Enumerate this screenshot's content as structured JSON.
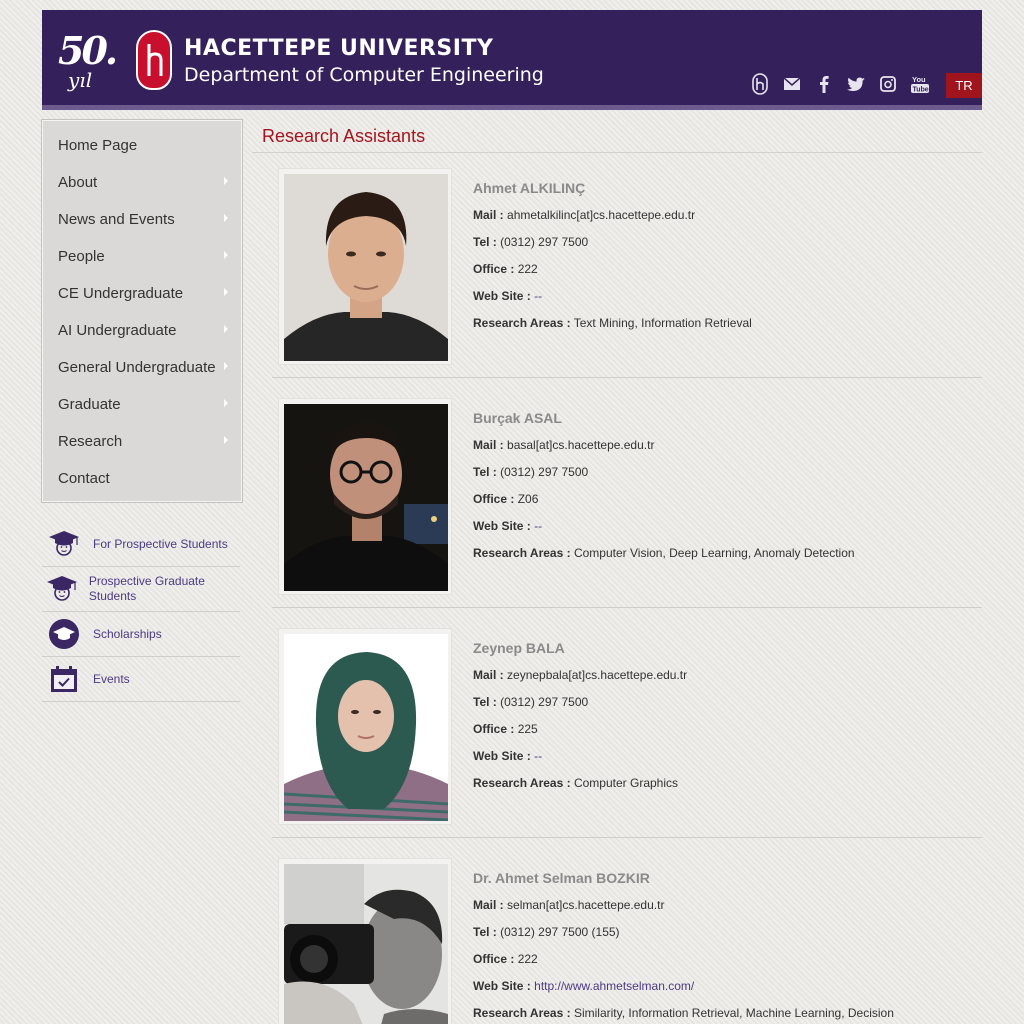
{
  "header": {
    "anniversary_number": "50.",
    "anniversary_word": "yıl",
    "university": "HACETTEPE UNIVERSITY",
    "department": "Department of Computer Engineering",
    "social_icons": [
      "hacettepe-icon",
      "mail-icon",
      "facebook-icon",
      "twitter-icon",
      "instagram-icon",
      "youtube-icon"
    ],
    "youtube_text": "You\nTube",
    "lang_button": "TR"
  },
  "colors": {
    "header_bg": "#34205a",
    "accent_red": "#a3151f",
    "link": "#4d3a82"
  },
  "menu": {
    "items": [
      {
        "label": "Home Page",
        "submenu": false
      },
      {
        "label": "About",
        "submenu": true
      },
      {
        "label": "News and Events",
        "submenu": true
      },
      {
        "label": "People",
        "submenu": true
      },
      {
        "label": "CE Undergraduate",
        "submenu": true
      },
      {
        "label": "AI Undergraduate",
        "submenu": true
      },
      {
        "label": "General Undergraduate",
        "submenu": true
      },
      {
        "label": "Graduate",
        "submenu": true
      },
      {
        "label": "Research",
        "submenu": true
      },
      {
        "label": "Contact",
        "submenu": false
      }
    ]
  },
  "quick_links": [
    {
      "label": "For Prospective Students",
      "icon": "graduation-cap-icon"
    },
    {
      "label": "Prospective Graduate Students",
      "icon": "graduation-cap-icon"
    },
    {
      "label": "Scholarships",
      "icon": "scholarship-cap-icon"
    },
    {
      "label": "Events",
      "icon": "calendar-icon"
    }
  ],
  "main": {
    "title": "Research Assistants",
    "labels": {
      "mail": "Mail :",
      "tel": "Tel :",
      "office": "Office :",
      "web": "Web Site :",
      "areas": "Research Areas :"
    },
    "people": [
      {
        "name": "Ahmet ALKILINÇ",
        "mail": "ahmetalkilinc[at]cs.hacettepe.edu.tr",
        "tel": "(0312) 297 7500",
        "office": "222",
        "web": "--",
        "areas": "Text Mining, Information Retrieval"
      },
      {
        "name": "Burçak ASAL",
        "mail": "basal[at]cs.hacettepe.edu.tr",
        "tel": "(0312) 297 7500",
        "office": "Z06",
        "web": "--",
        "areas": "Computer Vision, Deep Learning, Anomaly Detection"
      },
      {
        "name": "Zeynep BALA",
        "mail": "zeynepbala[at]cs.hacettepe.edu.tr",
        "tel": "(0312) 297 7500",
        "office": "225",
        "web": "--",
        "areas": "Computer Graphics"
      },
      {
        "name": "Dr. Ahmet Selman BOZKIR",
        "mail": "selman[at]cs.hacettepe.edu.tr",
        "tel": "(0312) 297 7500 (155)",
        "office": "222",
        "web": "http://www.ahmetselman.com/",
        "areas": "Similarity, Information Retrieval, Machine Learning, Decision"
      }
    ]
  }
}
